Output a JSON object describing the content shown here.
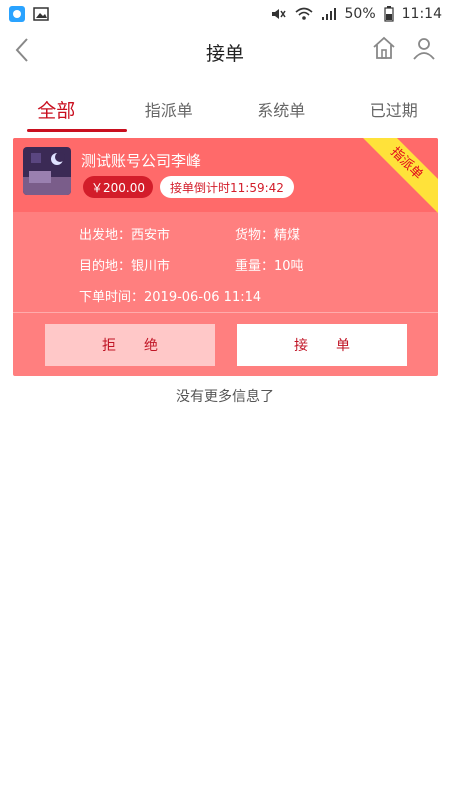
{
  "statusbar": {
    "battery": "50%",
    "time": "11:14",
    "icons": [
      "app-icon",
      "image-icon",
      "mute-icon",
      "wifi-icon",
      "signal-icon",
      "battery-icon"
    ]
  },
  "header": {
    "title": "接单",
    "icons": [
      "back-chevron-icon",
      "home-icon",
      "user-icon"
    ]
  },
  "tabs": [
    {
      "label": "全部",
      "active": true
    },
    {
      "label": "指派单",
      "active": false
    },
    {
      "label": "系统单",
      "active": false
    },
    {
      "label": "已过期",
      "active": false
    }
  ],
  "order": {
    "company": "测试账号公司李峰",
    "price": "￥200.00",
    "countdown": "接单倒计时11:59:42",
    "ribbon": "指派单",
    "departure": "出发地：西安市",
    "destination": "目的地：银川市",
    "cargo": "货物：精煤",
    "weight": "重量：10吨",
    "order_time": "下单时间：2019-06-06 11:14",
    "refuse_label": "拒绝",
    "accept_label": "接单"
  },
  "footer_note": "没有更多信息了",
  "colors": {
    "accent": "#c90f1f",
    "card_bg": "#ff7f7f",
    "card_header_bg": "#ff6a6a",
    "ribbon": "#ffe23a"
  }
}
